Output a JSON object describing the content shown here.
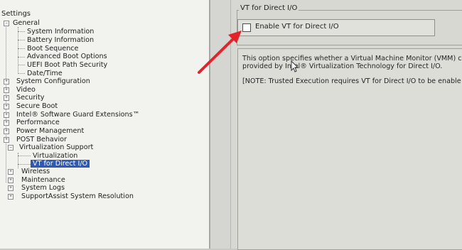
{
  "left_panel": {
    "header": "Settings",
    "tree": [
      {
        "label": "General",
        "level": 0,
        "expanded": true
      },
      {
        "label": "System Information",
        "level": 1
      },
      {
        "label": "Battery Information",
        "level": 1
      },
      {
        "label": "Boot Sequence",
        "level": 1
      },
      {
        "label": "Advanced Boot Options",
        "level": 1
      },
      {
        "label": "UEFI Boot Path Security",
        "level": 1
      },
      {
        "label": "Date/Time",
        "level": 1
      },
      {
        "label": "System Configuration",
        "level": 0,
        "expanded": false
      },
      {
        "label": "Video",
        "level": 0,
        "expanded": false
      },
      {
        "label": "Security",
        "level": 0,
        "expanded": false
      },
      {
        "label": "Secure Boot",
        "level": 0,
        "expanded": false
      },
      {
        "label": "Intel® Software Guard Extensions™",
        "level": 0,
        "expanded": false
      },
      {
        "label": "Performance",
        "level": 0,
        "expanded": false
      },
      {
        "label": "Power Management",
        "level": 0,
        "expanded": false
      },
      {
        "label": "POST Behavior",
        "level": 0,
        "expanded": false
      },
      {
        "label": "Virtualization Support",
        "level": 0,
        "expanded": true
      },
      {
        "label": "Virtualization",
        "level": 1
      },
      {
        "label": "VT for Direct I/O",
        "level": 1,
        "selected": true
      },
      {
        "label": "Wireless",
        "level": 0,
        "expanded": false
      },
      {
        "label": "Maintenance",
        "level": 0,
        "expanded": false
      },
      {
        "label": "System Logs",
        "level": 0,
        "expanded": false
      },
      {
        "label": "SupportAssist System Resolution",
        "level": 0,
        "expanded": false
      }
    ]
  },
  "right_panel": {
    "group_title": "VT for Direct I/O",
    "checkbox_label": "Enable VT for Direct I/O",
    "checkbox_checked": false,
    "description_1_line1": "This option specifies whether a Virtual Machine Monitor (VMM) c",
    "description_1_line2": "provided by Intel® Virtualization Technology for Direct I/O.",
    "description_2": "[NOTE: Trusted Execution requires VT for Direct I/O to be enable"
  },
  "colors": {
    "selection": "#2f59b3",
    "annotation_arrow": "#e3232a"
  }
}
